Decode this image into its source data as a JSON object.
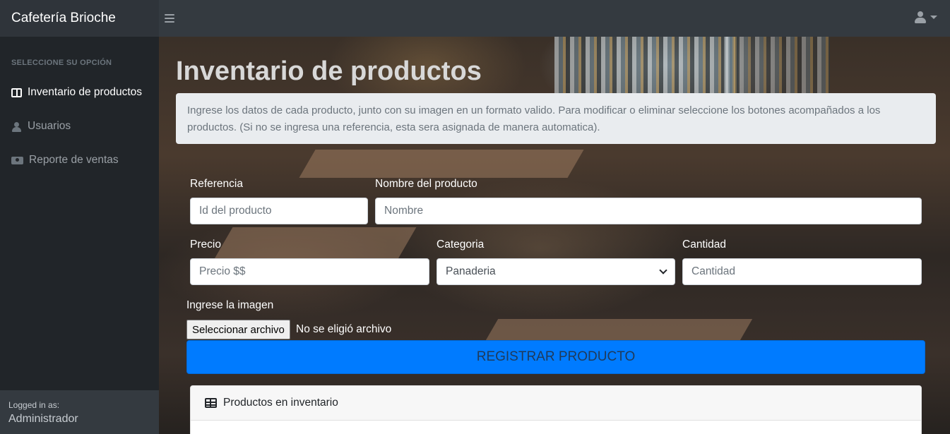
{
  "app": {
    "brand": "Cafetería Brioche"
  },
  "sidebar": {
    "heading": "SELECCIONE SU OPCIÓN",
    "items": [
      {
        "label": "Inventario de productos",
        "icon": "book-open-icon"
      },
      {
        "label": "Usuarios",
        "icon": "user-icon"
      },
      {
        "label": "Reporte de ventas",
        "icon": "money-bill-icon"
      }
    ],
    "footer": {
      "logged_label": "Logged in as:",
      "user": "Administrador"
    }
  },
  "main": {
    "title": "Inventario de productos",
    "info": "Ingrese los datos de cada producto, junto con su imagen en un formato valido. Para modificar o eliminar seleccione los botones acompañados a los productos. (Si no se ingresa una referencia, esta sera asignada de manera automatica).",
    "form": {
      "referencia": {
        "label": "Referencia",
        "placeholder": "Id del producto"
      },
      "nombre": {
        "label": "Nombre del producto",
        "placeholder": "Nombre"
      },
      "precio": {
        "label": "Precio",
        "placeholder": "Precio $$"
      },
      "categoria": {
        "label": "Categoria",
        "selected": "Panaderia"
      },
      "cantidad": {
        "label": "Cantidad",
        "placeholder": "Cantidad"
      },
      "imagen": {
        "label": "Ingrese la imagen",
        "button": "Seleccionar archivo",
        "status": "No se eligió archivo"
      },
      "submit": "REGISTRAR PRODUCTO"
    },
    "inventory_card": {
      "title": "Productos en inventario"
    }
  },
  "colors": {
    "primary": "#007bff",
    "sidebar": "#212529",
    "navbar": "#343a40",
    "info_box": "#e9ecef"
  }
}
